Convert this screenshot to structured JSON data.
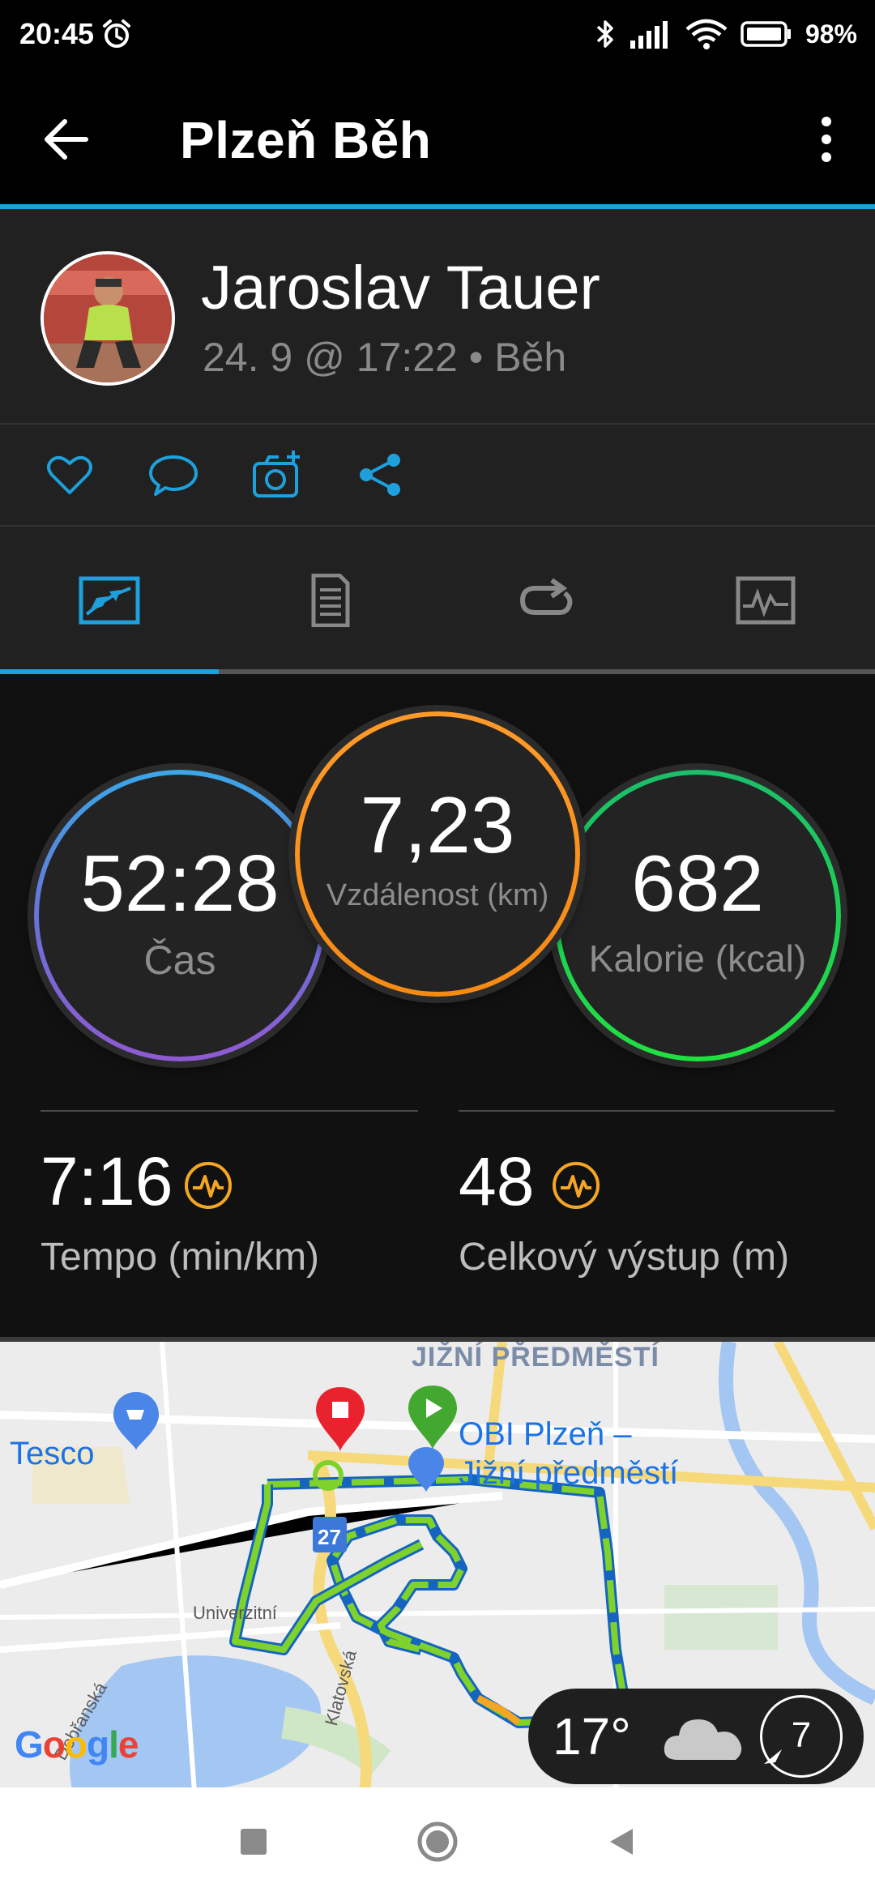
{
  "status_bar": {
    "time": "20:45",
    "battery": "98%"
  },
  "app_bar": {
    "title": "Plzeň Běh"
  },
  "profile": {
    "name": "Jaroslav Tauer",
    "meta": "24. 9 @ 17:22 • Běh"
  },
  "stats": {
    "time": {
      "value": "52:28",
      "label": "Čas"
    },
    "distance": {
      "value": "7,23",
      "label": "Vzdálenost (km)"
    },
    "calories": {
      "value": "682",
      "label": "Kalorie (kcal)"
    },
    "tempo": {
      "value": "7:16",
      "label": "Tempo (min/km)"
    },
    "climb": {
      "value": "48",
      "label": "Celkový výstup (m)"
    }
  },
  "map": {
    "area_label": "JIŽNÍ PŘEDMĚSTÍ",
    "poi_tesco": "Tesco",
    "poi_obi_line1": "OBI Plzeň –",
    "poi_obi_line2": "Jižní předměstí",
    "road_univerzitni": "Univerzitní",
    "road_klatovska": "Klatovská",
    "road_dobrovska": "Dobřanská",
    "road_number": "27",
    "attribution": "Google"
  },
  "weather": {
    "temperature": "17°",
    "wind": "7"
  },
  "colors": {
    "accent": "#1ea0dc",
    "distance_ring": "#f58a14",
    "calories_ring": "#20e040",
    "time_ring": "#3aa7e8"
  }
}
